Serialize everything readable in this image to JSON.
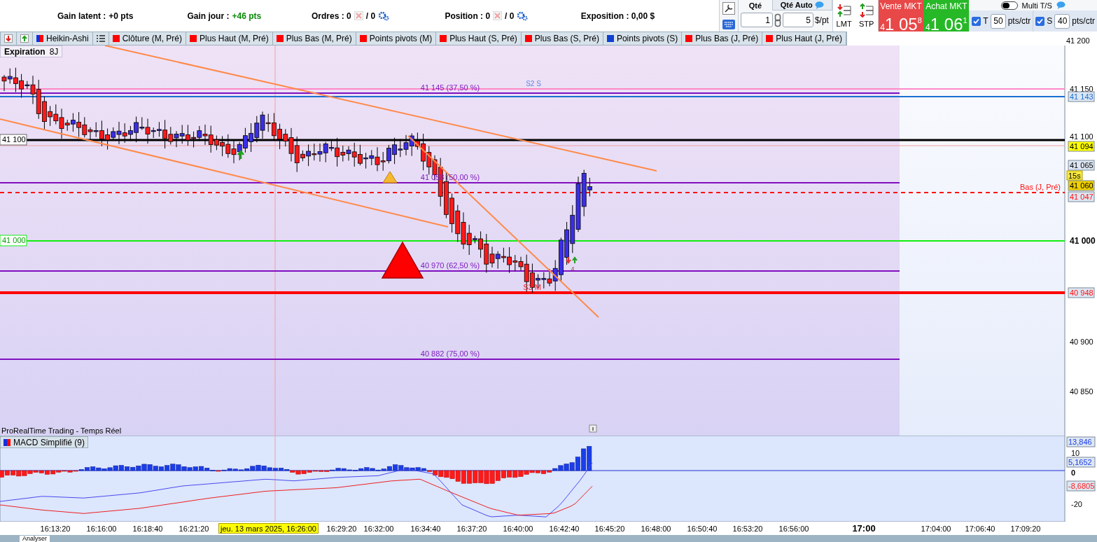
{
  "stats": [
    {
      "kind": "gain",
      "label": "Gain latent :",
      "value": "+0 pts",
      "positive": false
    },
    {
      "kind": "gain",
      "label": "Gain jour :",
      "value": "+46 pts",
      "positive": true
    },
    {
      "kind": "count",
      "label": "Ordres : 0",
      "total": "/ 0"
    },
    {
      "kind": "count",
      "label": "Position : 0",
      "total": "/ 0"
    },
    {
      "kind": "plain",
      "label": "Exposition : 0,00 $"
    }
  ],
  "order_panel": {
    "qty_label": "Qté",
    "auto_label": "Qté Auto",
    "qty": "1",
    "amount": "5",
    "unit": "$/pt",
    "limit_label": "LMT",
    "stop_label": "STP",
    "sell": {
      "label": "Vente MKT",
      "prefix": "4",
      "main": "1 05",
      "sup": "8"
    },
    "buy": {
      "label": "Achat MKT",
      "prefix": "4",
      "main": "1 06",
      "sup": "1"
    },
    "multi": {
      "label": "Multi T/S",
      "on": false
    },
    "stops": [
      {
        "checked": true,
        "label": "T",
        "value": "50",
        "unit": "pts/ctr"
      },
      {
        "checked": true,
        "label": "S",
        "value": "40",
        "unit": "pts/ctr"
      }
    ]
  },
  "indicator_tags": [
    {
      "kind": "split",
      "label": "Heikin-Ashi"
    },
    {
      "kind": "list"
    },
    {
      "kind": "color",
      "label": "Clôture (M, Pré)",
      "color": "#ff0000"
    },
    {
      "kind": "color",
      "label": "Plus Haut (M, Pré)",
      "color": "#ff0000"
    },
    {
      "kind": "color",
      "label": "Plus Bas (M, Pré)",
      "color": "#ff0000"
    },
    {
      "kind": "color",
      "label": "Points pivots (M)",
      "color": "#ff0000"
    },
    {
      "kind": "color",
      "label": "Plus Haut (S, Pré)",
      "color": "#ff0000"
    },
    {
      "kind": "color",
      "label": "Plus Bas (S, Pré)",
      "color": "#ff0000"
    },
    {
      "kind": "color",
      "label": "Points pivots (S)",
      "color": "#1040d0"
    },
    {
      "kind": "color",
      "label": "Plus Bas (J, Pré)",
      "color": "#ff0000"
    },
    {
      "kind": "color",
      "label": "Plus Haut (J, Pré)",
      "color": "#ff0000"
    }
  ],
  "expiration": {
    "label": "Expiration",
    "value": "8J"
  },
  "chart": {
    "fib_labels": [
      "41 145 (37,50 %)",
      "41 058 (50,00 %)",
      "40 970 (62,50 %)",
      "40 882 (75,00 %)"
    ],
    "low_prev_day": "Bas (J, Pré)",
    "s3": "S3 M",
    "s2": "S2 S",
    "signal_count": "4",
    "left_tags": [
      {
        "text": "41 100",
        "kind": "boxed"
      },
      {
        "text": "41 000",
        "kind": "green"
      }
    ],
    "footer": "ProRealTime Trading - Temps Réel"
  },
  "price_axis": {
    "ticks": [
      {
        "label": "41 200",
        "major": false
      },
      {
        "label": "41 150",
        "major": false
      },
      {
        "label": "41 100",
        "major": false
      },
      {
        "label": "41 000",
        "major": true
      },
      {
        "label": "40 900",
        "major": false
      },
      {
        "label": "40 850",
        "major": false
      }
    ],
    "tags": [
      {
        "text": "41 143",
        "kind": "blue"
      },
      {
        "text": "41 094",
        "kind": "yellow"
      },
      {
        "text": "41 065",
        "kind": "plain"
      },
      {
        "text": "41 060",
        "kind": "gold"
      },
      {
        "text": "41 047",
        "kind": "red"
      },
      {
        "text": "40 948",
        "kind": "red"
      }
    ],
    "timer": "15s"
  },
  "macd": {
    "title": "MACD Simplifié (9)",
    "ticks": [
      "10",
      "0",
      "-20"
    ],
    "tags": [
      {
        "text": "13,846",
        "color": "#1a3ee8"
      },
      {
        "text": "5,1652",
        "color": "#1a3ee8"
      },
      {
        "text": "-8,6805",
        "color": "#ff2020"
      }
    ]
  },
  "time_axis": {
    "ticks": [
      {
        "label": "16:13:20",
        "major": false
      },
      {
        "label": "16:16:00",
        "major": false
      },
      {
        "label": "16:18:40",
        "major": false
      },
      {
        "label": "16:21:20",
        "major": false
      },
      {
        "label": "16:29:20",
        "major": false
      },
      {
        "label": "16:32:00",
        "major": false
      },
      {
        "label": "16:34:40",
        "major": false
      },
      {
        "label": "16:37:20",
        "major": false
      },
      {
        "label": "16:40:00",
        "major": false
      },
      {
        "label": "16:42:40",
        "major": false
      },
      {
        "label": "16:45:20",
        "major": false
      },
      {
        "label": "16:48:00",
        "major": false
      },
      {
        "label": "16:50:40",
        "major": false
      },
      {
        "label": "16:53:20",
        "major": false
      },
      {
        "label": "16:56:00",
        "major": false
      },
      {
        "label": "17:00",
        "major": true
      },
      {
        "label": "17:04:00",
        "major": false
      },
      {
        "label": "17:06:40",
        "major": false
      },
      {
        "label": "17:09:20",
        "major": false
      }
    ],
    "cursor": "jeu. 13 mars 2025, 16:26:00"
  },
  "taskbar": {
    "tab": "Analyser"
  }
}
